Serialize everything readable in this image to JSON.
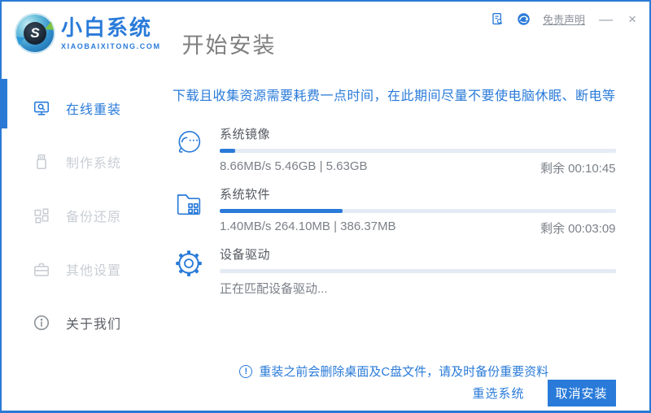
{
  "titlebar": {
    "brand_name": "小白系统",
    "brand_domain": "XIAOBAIXITONG.COM",
    "page_title": "开始安装",
    "disclaimer": "免责声明",
    "minimize": "—",
    "close": "×"
  },
  "sidebar": {
    "items": [
      {
        "label": "在线重装",
        "icon": "monitor-search-icon",
        "state": "active"
      },
      {
        "label": "制作系统",
        "icon": "usb-drive-icon",
        "state": "dim"
      },
      {
        "label": "备份还原",
        "icon": "backup-squares-icon",
        "state": "dim"
      },
      {
        "label": "其他设置",
        "icon": "toolbox-icon",
        "state": "dim"
      },
      {
        "label": "关于我们",
        "icon": "info-icon",
        "state": "about"
      }
    ]
  },
  "main": {
    "warning": "下载且收集资源需要耗费一点时间，在此期间尽量不要使电脑休眠、断电等",
    "tasks": [
      {
        "title": "系统镜像",
        "icon": "mascot-face-icon",
        "progress_percent": 4,
        "stats_left": "8.66MB/s 5.46GB | 5.63GB",
        "stats_right": "剩余 00:10:45"
      },
      {
        "title": "系统软件",
        "icon": "folder-apps-icon",
        "progress_percent": 31,
        "stats_left": "1.40MB/s 264.10MB | 386.37MB",
        "stats_right": "剩余 00:03:09"
      },
      {
        "title": "设备驱动",
        "icon": "gear-icon",
        "progress_percent": 0,
        "stats_left": "正在匹配设备驱动...",
        "stats_right": ""
      }
    ],
    "notice": {
      "icon_glyph": "!",
      "text": "重装之前会删除桌面及C盘文件，请及时备份重要资料"
    }
  },
  "footer": {
    "reselect": "重选系统",
    "cancel": "取消安装"
  },
  "colors": {
    "accent": "#2a7bd9",
    "window_border": "#2a7ad5",
    "track": "#e4ebf4",
    "dim_text": "#c9ced4"
  }
}
